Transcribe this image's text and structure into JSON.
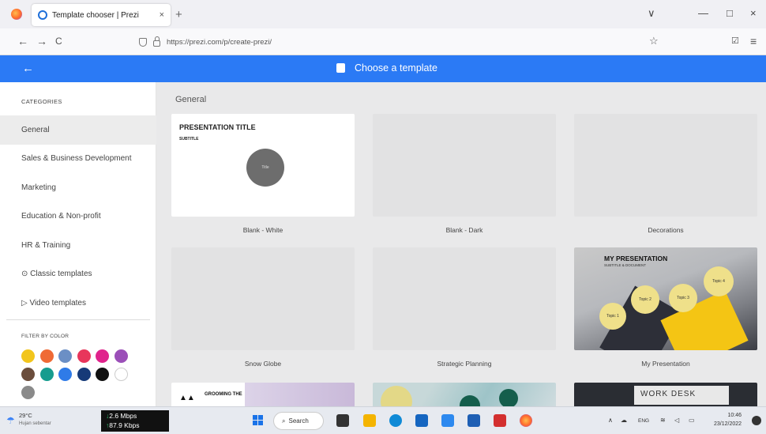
{
  "browser": {
    "tab_title": "Template chooser | Prezi",
    "tab_close": "×",
    "new_tab": "+",
    "url": "https://prezi.com/p/create-prezi/",
    "back": "←",
    "forward": "→",
    "reload": "C",
    "star": "☆",
    "pocket": "☑",
    "menu": "≡",
    "tab_list": "∨",
    "minimize": "—",
    "restore": "□",
    "close": "×"
  },
  "header": {
    "back": "←",
    "title": "Choose a template"
  },
  "sidebar": {
    "categories_heading": "CATEGORIES",
    "items": [
      {
        "label": "General"
      },
      {
        "label": "Sales & Business Development"
      },
      {
        "label": "Marketing"
      },
      {
        "label": "Education & Non-profit"
      },
      {
        "label": "HR & Training"
      },
      {
        "label": "⊙ Classic templates"
      },
      {
        "label": "▷ Video templates"
      }
    ],
    "filter_heading": "FILTER BY COLOR",
    "colors": [
      "#f2c51c",
      "#ef6a35",
      "#6b8fc5",
      "#e8365b",
      "#e0238c",
      "#9b4fb8",
      "#6b4d3c",
      "#169c8f",
      "#2f7be8",
      "#163a78",
      "#111111",
      "#ffffff",
      "#8a8a8a"
    ]
  },
  "main": {
    "section_title": "General",
    "templates": [
      {
        "label": "Blank - White",
        "title": "PRESENTATION TITLE",
        "subtitle": "SUBTITLE",
        "circle": "Title"
      },
      {
        "label": "Blank - Dark"
      },
      {
        "label": "Decorations"
      },
      {
        "label": "Snow Globe"
      },
      {
        "label": "Strategic Planning"
      },
      {
        "label": "My Presentation",
        "title": "MY PRESENTATION",
        "subtitle": "SUBTITLE & DOCUMENT",
        "topics": [
          "Topic 1",
          "Topic 2",
          "Topic 3",
          "Topic 4"
        ]
      }
    ],
    "peek": [
      {
        "text": "GROOMING THE"
      },
      {
        "text": ""
      },
      {
        "text": "WORK DESK"
      }
    ]
  },
  "taskbar": {
    "weather_temp": "29°C",
    "weather_desc": "Hujan sebentar",
    "net_down": "2.6 Mbps",
    "net_up": "87.9 Kbps",
    "search": "Search",
    "lang": "ENG",
    "time": "10:46",
    "date": "23/12/2022"
  }
}
